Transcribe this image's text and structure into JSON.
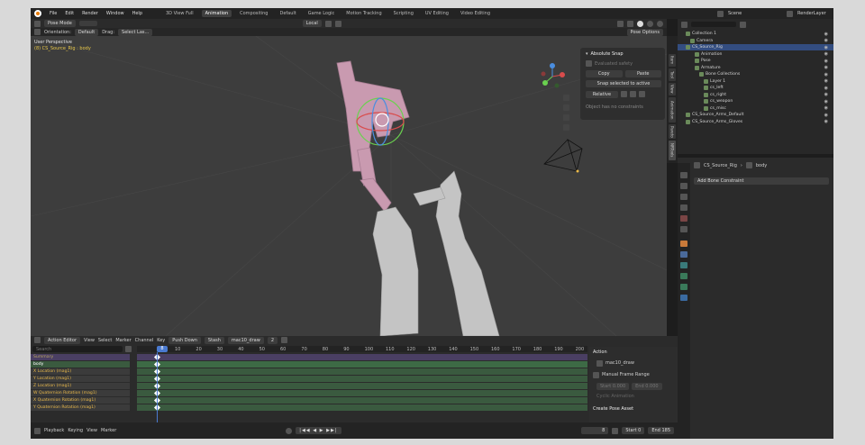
{
  "menus": [
    "File",
    "Edit",
    "Render",
    "Window",
    "Help"
  ],
  "workspaces": [
    {
      "label": "3D View Full",
      "active": false
    },
    {
      "label": "Animation",
      "active": true
    },
    {
      "label": "Compositing",
      "active": false
    },
    {
      "label": "Default",
      "active": false
    },
    {
      "label": "Game Logic",
      "active": false
    },
    {
      "label": "Motion Tracking",
      "active": false
    },
    {
      "label": "Scripting",
      "active": false
    },
    {
      "label": "UV Editing",
      "active": false
    },
    {
      "label": "Video Editing",
      "active": false
    }
  ],
  "scene": {
    "name": "Scene",
    "view_layer": "RenderLayer"
  },
  "viewport_header": {
    "mode": "Pose Mode",
    "transform_orientation": "Local",
    "pose_options": "Pose Options"
  },
  "tool_settings": {
    "orientation_label": "Orientation:",
    "orientation_value": "Default",
    "drag_label": "Drag:",
    "drag_value": "Select Las..."
  },
  "viewport_info": {
    "view": "User Perspective",
    "object": "(8) CS_Source_Rig : body"
  },
  "sidebar": {
    "title": "Absolute Snap",
    "disabled_text": "Evaluated safety",
    "copy": "Copy",
    "paste": "Paste",
    "snap_button": "Snap selected to active",
    "relative": "Relative",
    "status": "Object has no constraints",
    "tabs": [
      "Item",
      "Tool",
      "View",
      "Animation",
      "Pareto",
      "NRTools"
    ]
  },
  "outliner": {
    "search_placeholder": "",
    "rows": [
      {
        "label": "Collection 1",
        "indent": 1,
        "sel": false
      },
      {
        "label": "Camera",
        "indent": 2,
        "sel": false
      },
      {
        "label": "CS_Source_Rig",
        "indent": 1,
        "sel": true
      },
      {
        "label": "Animation",
        "indent": 3,
        "sel": false
      },
      {
        "label": "Pose",
        "indent": 3,
        "sel": false
      },
      {
        "label": "Armature",
        "indent": 3,
        "sel": false
      },
      {
        "label": "Bone Collections",
        "indent": 4,
        "sel": false
      },
      {
        "label": "Layer 1",
        "indent": 5,
        "sel": false
      },
      {
        "label": "cs_left",
        "indent": 5,
        "sel": false
      },
      {
        "label": "cs_right",
        "indent": 5,
        "sel": false
      },
      {
        "label": "cs_weapon",
        "indent": 5,
        "sel": false
      },
      {
        "label": "cs_misc",
        "indent": 5,
        "sel": false
      },
      {
        "label": "CS_Source_Arms_Default",
        "indent": 1,
        "sel": false
      },
      {
        "label": "CS_Source_Arms_Gloves",
        "indent": 1,
        "sel": false
      }
    ]
  },
  "properties": {
    "breadcrumb_object": "CS_Source_Rig",
    "breadcrumb_bone": "body",
    "add_constraint": "Add Bone Constraint"
  },
  "action_editor": {
    "mode": "Action Editor",
    "menus": [
      "View",
      "Select",
      "Marker",
      "Channel",
      "Key"
    ],
    "push_down": "Push Down",
    "stash": "Stash",
    "action_name": "mac10_draw",
    "users": "2",
    "search_placeholder": "Search",
    "current_frame": "8",
    "frame_labels": [
      "10",
      "20",
      "30",
      "40",
      "50",
      "60",
      "70",
      "80",
      "90",
      "100",
      "110",
      "120",
      "130",
      "140",
      "150",
      "160",
      "170",
      "180",
      "190",
      "200"
    ],
    "channels": [
      {
        "label": "Summary",
        "color": "#b9a560",
        "bg": "#4a3f63"
      },
      {
        "label": "body",
        "color": "#ffffff",
        "bg": "#3a5a3f"
      },
      {
        "label": "X Location (mag1)",
        "color": "#e8b84a",
        "bg": "#3b3b3b"
      },
      {
        "label": "Y Location (mag1)",
        "color": "#e8b84a",
        "bg": "#3b3b3b"
      },
      {
        "label": "Z Location (mag1)",
        "color": "#e8b84a",
        "bg": "#3b3b3b"
      },
      {
        "label": "W Quaternion Rotation (mag1)",
        "color": "#e8b84a",
        "bg": "#3b3b3b"
      },
      {
        "label": "X Quaternion Rotation (mag1)",
        "color": "#e8b84a",
        "bg": "#3b3b3b"
      },
      {
        "label": "Y Quaternion Rotation (mag1)",
        "color": "#e8b84a",
        "bg": "#3b3b3b"
      }
    ]
  },
  "action_panel": {
    "header": "Action",
    "action": "mac10_draw",
    "manual_range": "Manual Frame Range",
    "start": "Start",
    "start_val": "0.000",
    "end": "End",
    "end_val": "0.000",
    "cyclic": "Cyclic Animation",
    "pose_asset": "Create Pose Asset"
  },
  "timeline": {
    "playback": "Playback",
    "keying": "Keying",
    "view": "View",
    "marker": "Marker",
    "current": "8",
    "start_label": "Start",
    "start": "0",
    "end_label": "End",
    "end": "185"
  }
}
